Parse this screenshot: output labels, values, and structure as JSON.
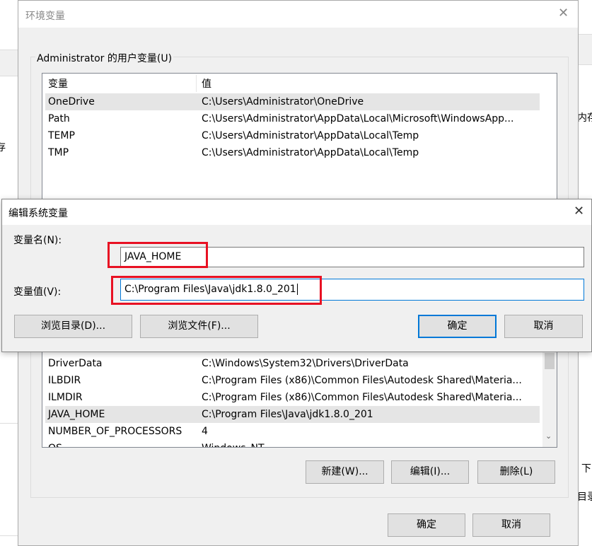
{
  "background": {
    "fragments": [
      "存",
      "内存",
      "下",
      "目录"
    ]
  },
  "env_dialog": {
    "title": "环境变量",
    "user_group_label": "Administrator 的用户变量(U)",
    "columns": [
      "变量",
      "值"
    ],
    "user_vars": [
      {
        "name": "OneDrive",
        "value": "C:\\Users\\Administrator\\OneDrive",
        "selected": true
      },
      {
        "name": "Path",
        "value": "C:\\Users\\Administrator\\AppData\\Local\\Microsoft\\WindowsApp..."
      },
      {
        "name": "TEMP",
        "value": "C:\\Users\\Administrator\\AppData\\Local\\Temp"
      },
      {
        "name": "TMP",
        "value": "C:\\Users\\Administrator\\AppData\\Local\\Temp"
      }
    ],
    "system_vars": [
      {
        "name": "DriverData",
        "value": "C:\\Windows\\System32\\Drivers\\DriverData"
      },
      {
        "name": "ILBDIR",
        "value": "C:\\Program Files (x86)\\Common Files\\Autodesk Shared\\Materia..."
      },
      {
        "name": "ILMDIR",
        "value": "C:\\Program Files (x86)\\Common Files\\Autodesk Shared\\Materia..."
      },
      {
        "name": "JAVA_HOME",
        "value": "C:\\Program Files\\Java\\jdk1.8.0_201",
        "selected": true
      },
      {
        "name": "NUMBER_OF_PROCESSORS",
        "value": "4"
      },
      {
        "name": "OS",
        "value": "Windows_NT"
      }
    ],
    "new_label": "新建(W)...",
    "edit_label": "编辑(I)...",
    "delete_label": "删除(L)",
    "ok_label": "确定",
    "cancel_label": "取消"
  },
  "edit_dialog": {
    "title": "编辑系统变量",
    "name_label": "变量名(N):",
    "name_value": "JAVA_HOME",
    "value_label": "变量值(V):",
    "value_value": "C:\\Program Files\\Java\\jdk1.8.0_201",
    "browse_dir_label": "浏览目录(D)...",
    "browse_file_label": "浏览文件(F)...",
    "ok_label": "确定",
    "cancel_label": "取消",
    "highlight_color": "#e81123",
    "focus_color": "#0078d7"
  }
}
